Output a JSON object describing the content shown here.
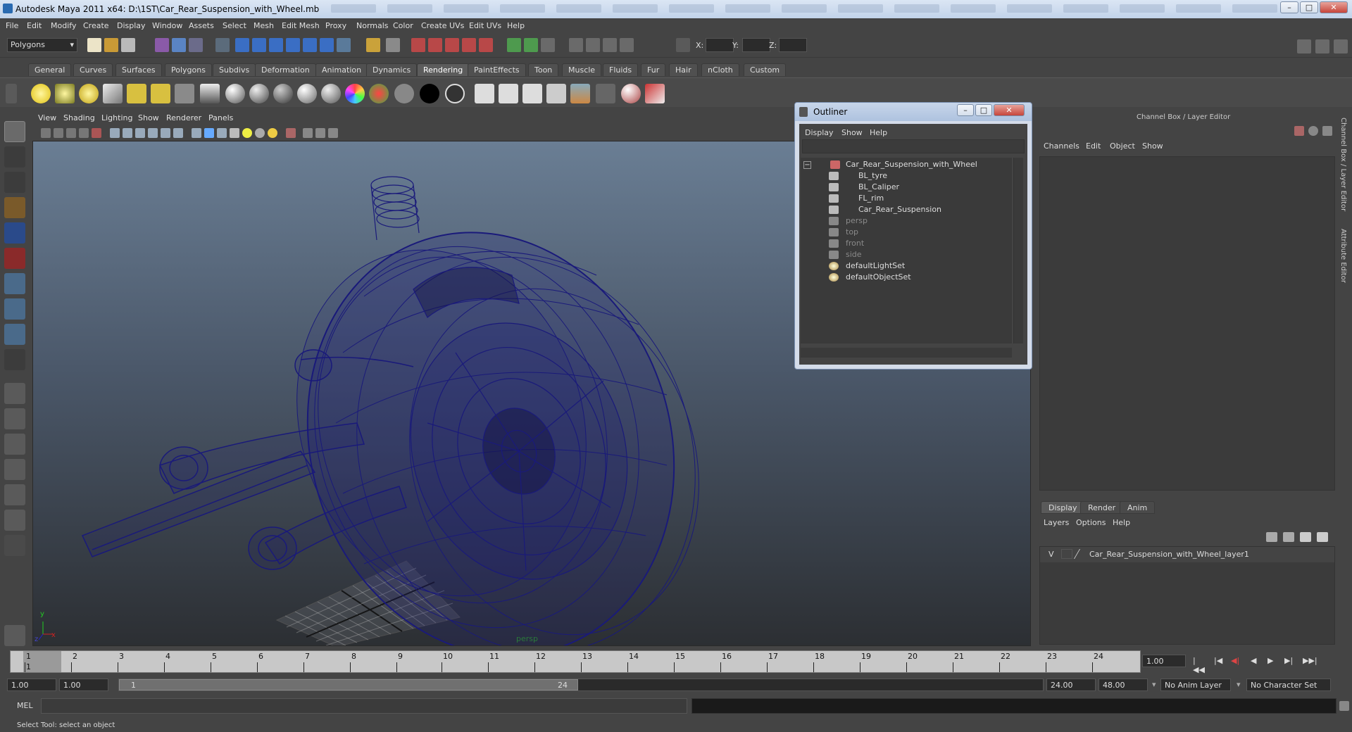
{
  "window": {
    "title": "Autodesk Maya 2011 x64: D:\\1ST\\Car_Rear_Suspension_with_Wheel.mb",
    "min": "–",
    "max": "□",
    "close": "✕"
  },
  "menubar": [
    "File",
    "Edit",
    "Modify",
    "Create",
    "Display",
    "Window",
    "Assets",
    "Select",
    "Mesh",
    "Edit Mesh",
    "Proxy",
    "Normals",
    "Color",
    "Create UVs",
    "Edit UVs",
    "Help"
  ],
  "statusline": {
    "mode": "Polygons",
    "x_label": "X:",
    "y_label": "Y:",
    "z_label": "Z:"
  },
  "shelf": {
    "tabs": [
      "General",
      "Curves",
      "Surfaces",
      "Polygons",
      "Subdivs",
      "Deformation",
      "Animation",
      "Dynamics",
      "Rendering",
      "PaintEffects",
      "Toon",
      "Muscle",
      "Fluids",
      "Fur",
      "Hair",
      "nCloth",
      "Custom"
    ],
    "active": "Rendering"
  },
  "viewport": {
    "menus": [
      "View",
      "Shading",
      "Lighting",
      "Show",
      "Renderer",
      "Panels"
    ],
    "camera_label": "persp",
    "axis_y": "y",
    "axis_x": "x",
    "axis_z": "z",
    "wire_color": "#1a1a7a"
  },
  "outliner": {
    "title": "Outliner",
    "menus": [
      "Display",
      "Show",
      "Help"
    ],
    "expand": "−",
    "items": [
      {
        "label": "Car_Rear_Suspension_with_Wheel"
      },
      {
        "label": "BL_tyre"
      },
      {
        "label": "BL_Caliper"
      },
      {
        "label": "FL_rim"
      },
      {
        "label": "Car_Rear_Suspension"
      },
      {
        "label": "persp"
      },
      {
        "label": "top"
      },
      {
        "label": "front"
      },
      {
        "label": "side"
      },
      {
        "label": "defaultLightSet"
      },
      {
        "label": "defaultObjectSet"
      }
    ]
  },
  "channelbox": {
    "title": "Channel Box / Layer Editor",
    "menus": [
      "Channels",
      "Edit",
      "Object",
      "Show"
    ]
  },
  "layers": {
    "tabs": [
      "Display",
      "Render",
      "Anim"
    ],
    "menus": [
      "Layers",
      "Options",
      "Help"
    ],
    "rows": [
      {
        "visible": "V",
        "name": "Car_Rear_Suspension_with_Wheel_layer1"
      }
    ]
  },
  "sidestrip": {
    "channel_label": "Channel Box / Layer Editor",
    "attr_label": "Attribute Editor"
  },
  "timeline": {
    "frames": [
      "1",
      "2",
      "3",
      "4",
      "5",
      "6",
      "7",
      "8",
      "9",
      "10",
      "11",
      "12",
      "13",
      "14",
      "15",
      "16",
      "17",
      "18",
      "19",
      "20",
      "21",
      "22",
      "23",
      "24"
    ],
    "current": "1",
    "current_field": "1.00",
    "pb_icons": [
      "|◀◀",
      "|◀",
      "◀|",
      "◀",
      "▶",
      "▶|",
      "▶▶|"
    ]
  },
  "range": {
    "start": "1.00",
    "start2": "1.00",
    "slider_start": "1",
    "slider_end": "24",
    "end": "24.00",
    "end2": "48.00",
    "anim_layer": "No Anim Layer",
    "char_set": "No Character Set"
  },
  "cmd": {
    "label": "MEL"
  },
  "help": {
    "text": "Select Tool: select an object"
  }
}
